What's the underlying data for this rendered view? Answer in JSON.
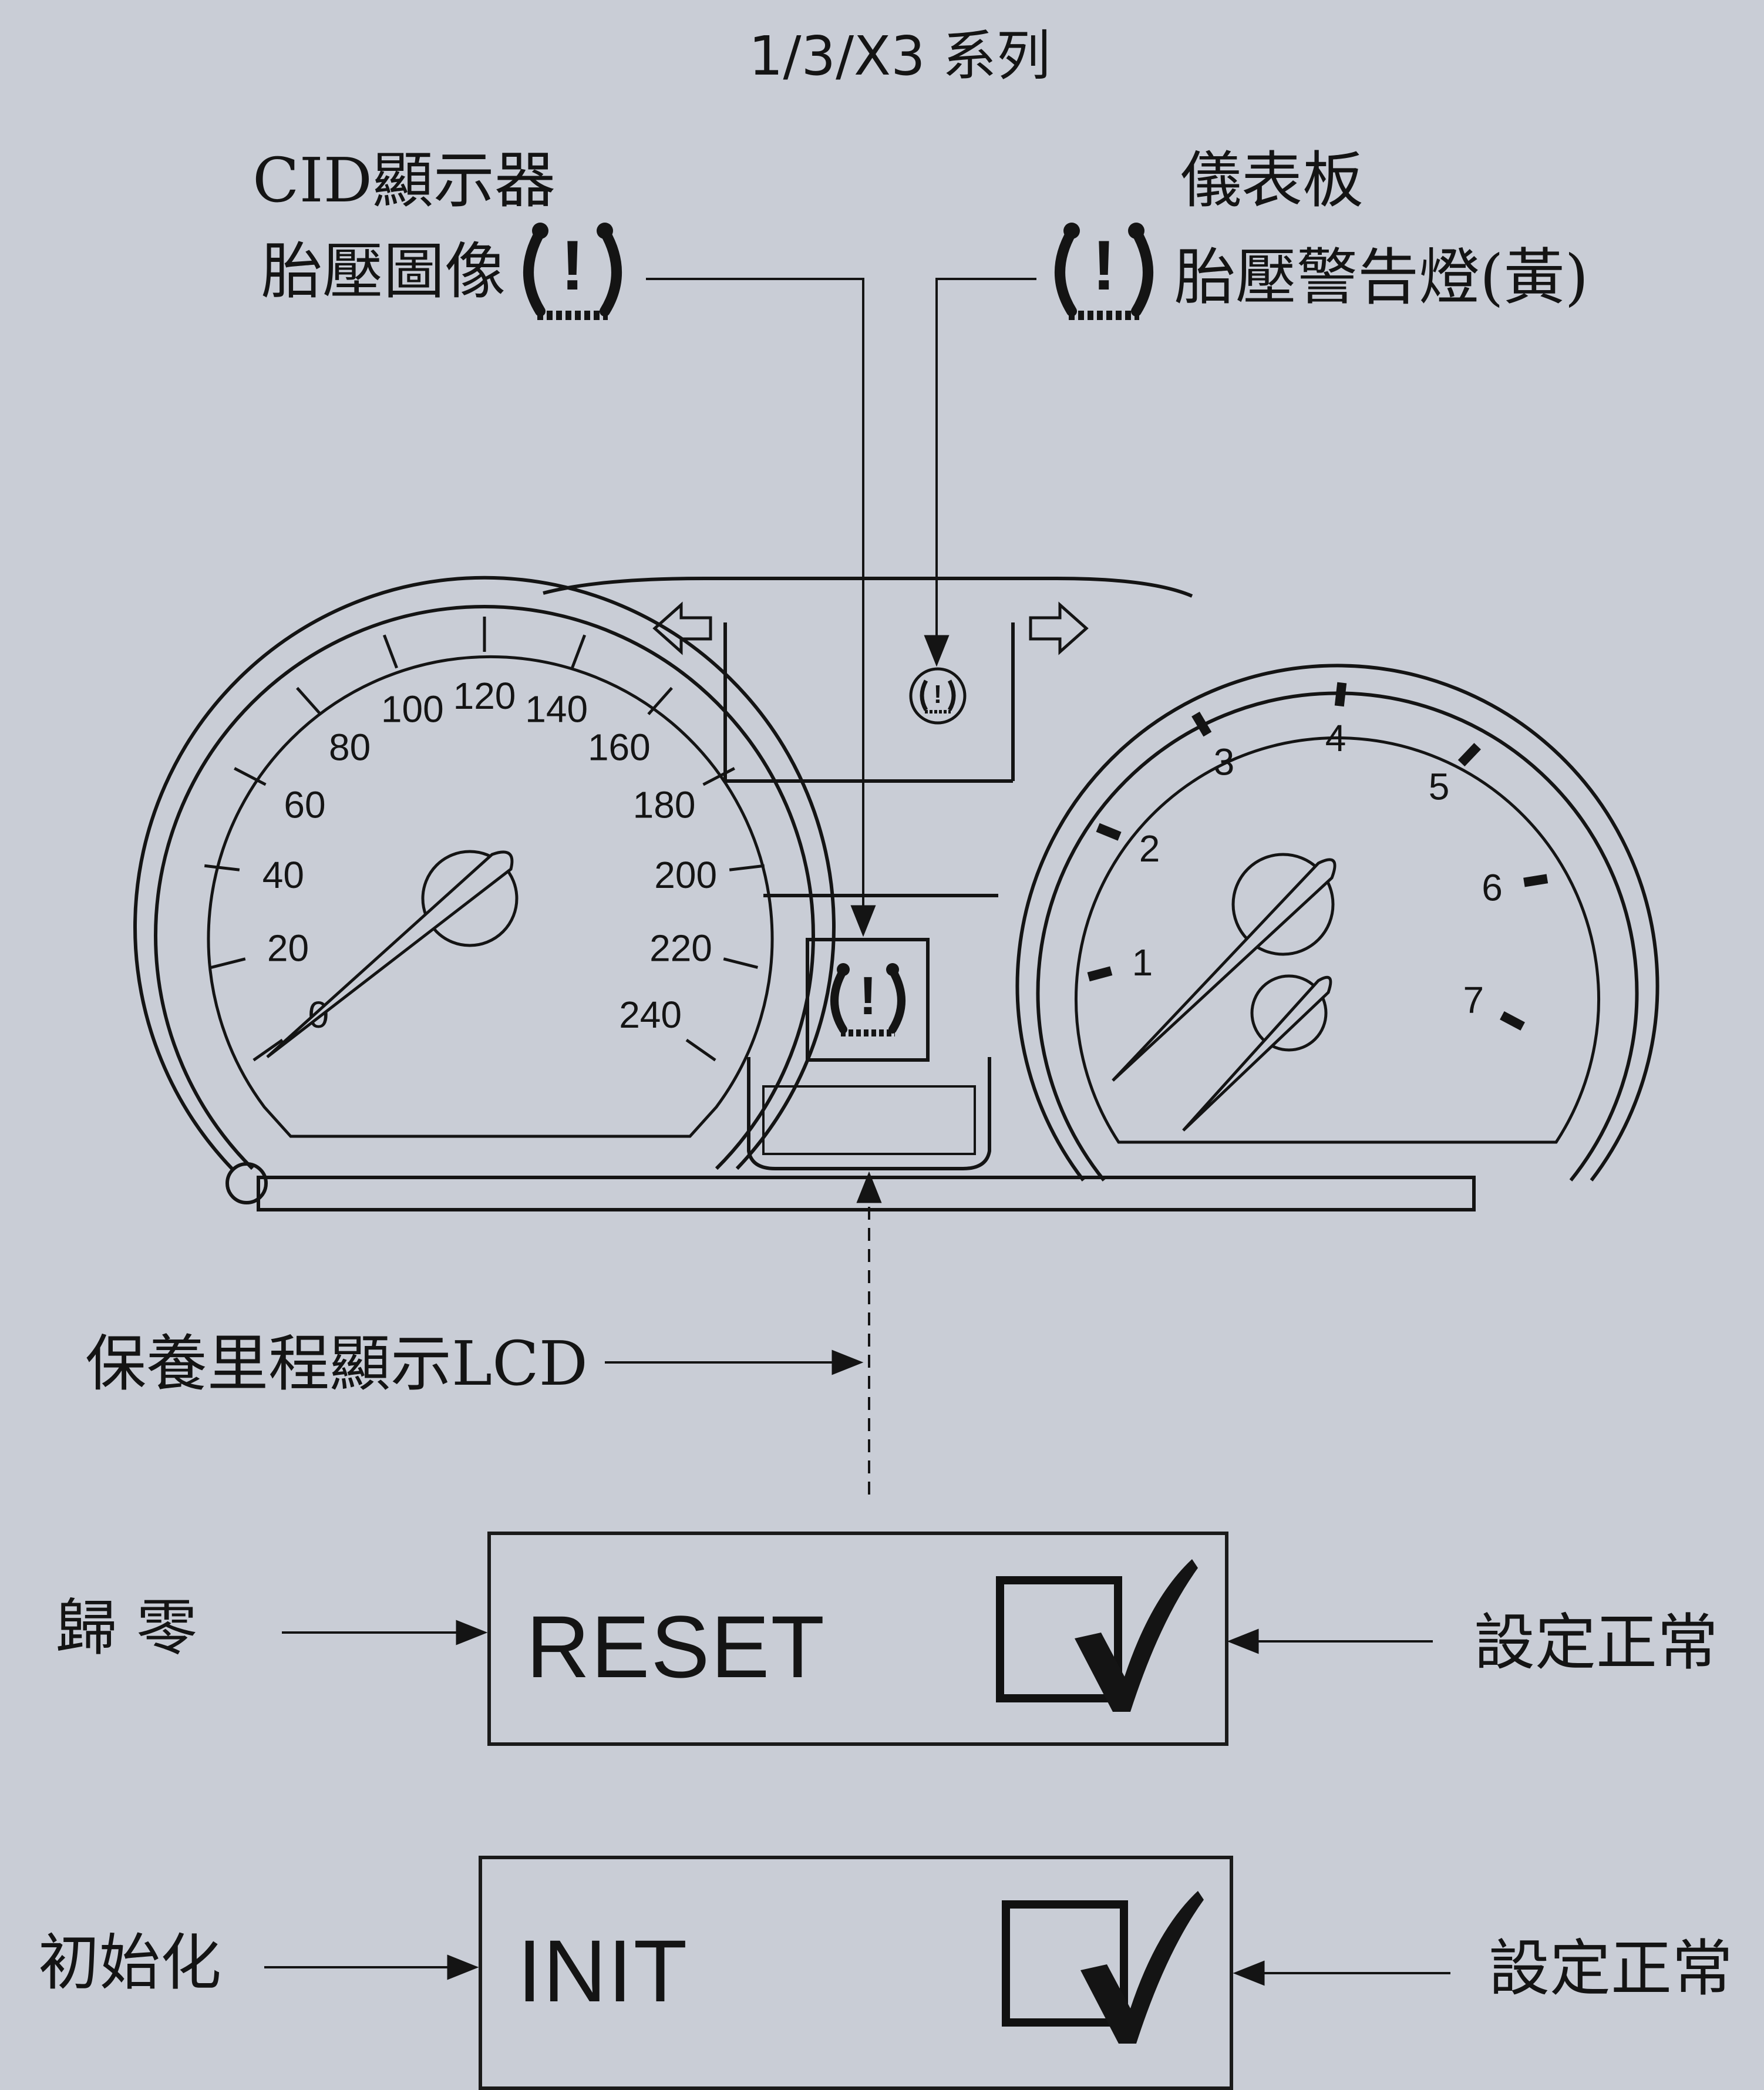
{
  "title": "1/3/X3 系列",
  "cid_label_line1": "CID顯示器",
  "cid_label_line2": "胎壓圖像",
  "panel_label_line1": "儀表板",
  "panel_label_line2": "胎壓警告燈(黃)",
  "lcd_label": "保養里程顯示LCD",
  "reset": {
    "left_label": "歸 零",
    "button_text": "RESET",
    "right_label": "設定正常"
  },
  "init": {
    "left_label": "初始化",
    "button_text": "INIT",
    "right_label": "設定正常"
  },
  "speedometer": {
    "labels": [
      "0",
      "20",
      "40",
      "60",
      "80",
      "100",
      "120",
      "140",
      "160",
      "180",
      "200",
      "220",
      "240"
    ]
  },
  "tachometer": {
    "labels": [
      "1",
      "2",
      "3",
      "4",
      "5",
      "6",
      "7"
    ]
  },
  "icons": {
    "tpms": "tire-pressure-warning-icon",
    "turn_left": "arrow-left-icon",
    "turn_right": "arrow-right-icon",
    "check": "checkmark-icon"
  },
  "colors": {
    "background": "#c9cdd6",
    "ink": "#141414"
  }
}
